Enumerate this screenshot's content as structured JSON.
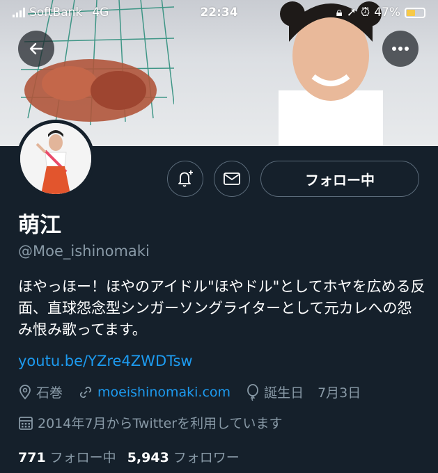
{
  "status_bar": {
    "carrier": "SoftBank",
    "network": "4G",
    "time": "22:34",
    "battery": "47%"
  },
  "banner": {
    "back_icon": "arrow-left-icon",
    "more_icon": "more-horizontal-icon"
  },
  "profile": {
    "display_name": "萌江",
    "handle": "@Moe_ishinomaki",
    "bio": "ほやっほー！ほやのアイドル\"ほやドル\"としてホヤを広める反面、直球怨念型シンガーソングライターとして元カレへの怨み恨み歌ってます。",
    "bio_link": "youtu.be/YZre4ZWDTsw",
    "location": "石巻",
    "website": "moeishinomaki.com",
    "birthday_label": "誕生日",
    "birthday": "7月3日",
    "joined": "2014年7月からTwitterを利用しています"
  },
  "actions": {
    "notify_icon": "bell-plus-icon",
    "message_icon": "mail-icon",
    "follow_label": "フォロー中"
  },
  "stats": {
    "following_count": "771",
    "following_label": "フォロー中",
    "followers_count": "5,943",
    "followers_label": "フォロワー"
  },
  "colors": {
    "background": "#15202b",
    "link": "#1d9bf0",
    "secondary_text": "#8899a6",
    "border": "#5b6b7a"
  }
}
